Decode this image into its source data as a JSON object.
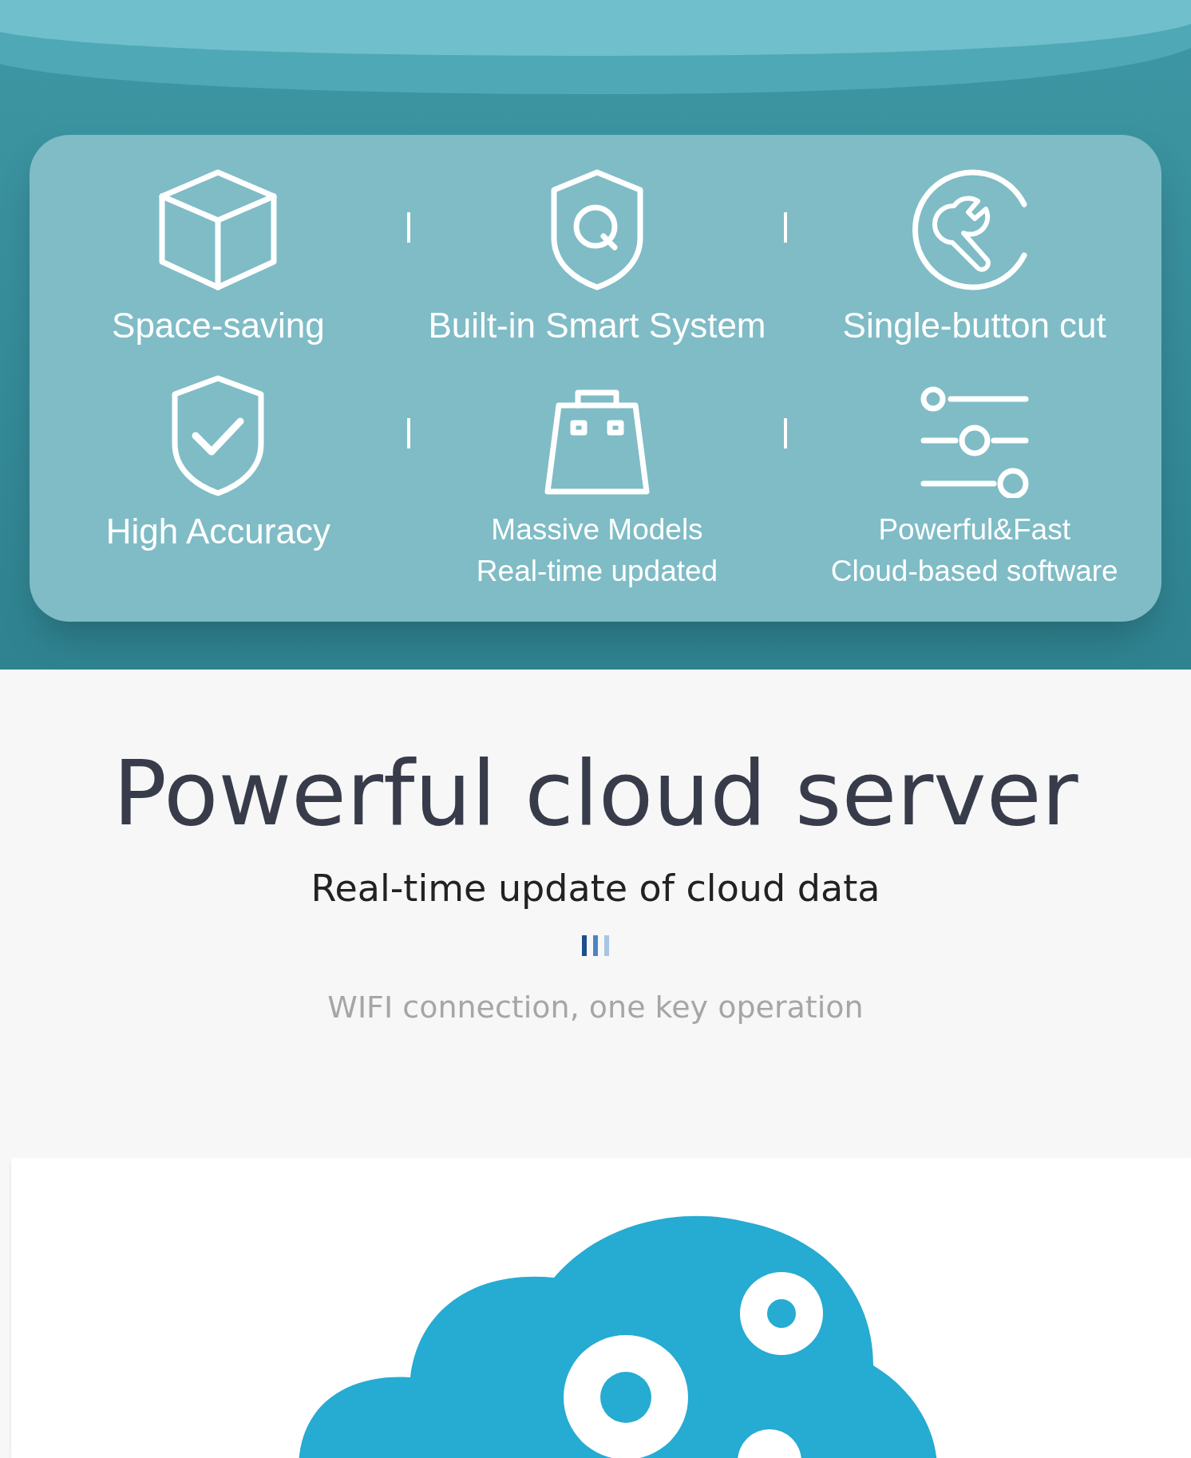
{
  "features": [
    {
      "kind": "cube",
      "lines": [
        "Space-saving"
      ]
    },
    {
      "kind": "shield-q",
      "lines": [
        "Built-in Smart System"
      ]
    },
    {
      "kind": "wrench",
      "lines": [
        "Single-button cut"
      ]
    },
    {
      "kind": "shield-check",
      "lines": [
        "High Accuracy"
      ]
    },
    {
      "kind": "bag",
      "lines": [
        "Massive Models",
        "Real-time updated"
      ]
    },
    {
      "kind": "sliders",
      "lines": [
        "Powerful&Fast",
        "Cloud-based software"
      ]
    }
  ],
  "section": {
    "title": "Powerful cloud server",
    "subtitle": "Real-time update of cloud data",
    "caption": "WIFI connection, one key operation"
  }
}
